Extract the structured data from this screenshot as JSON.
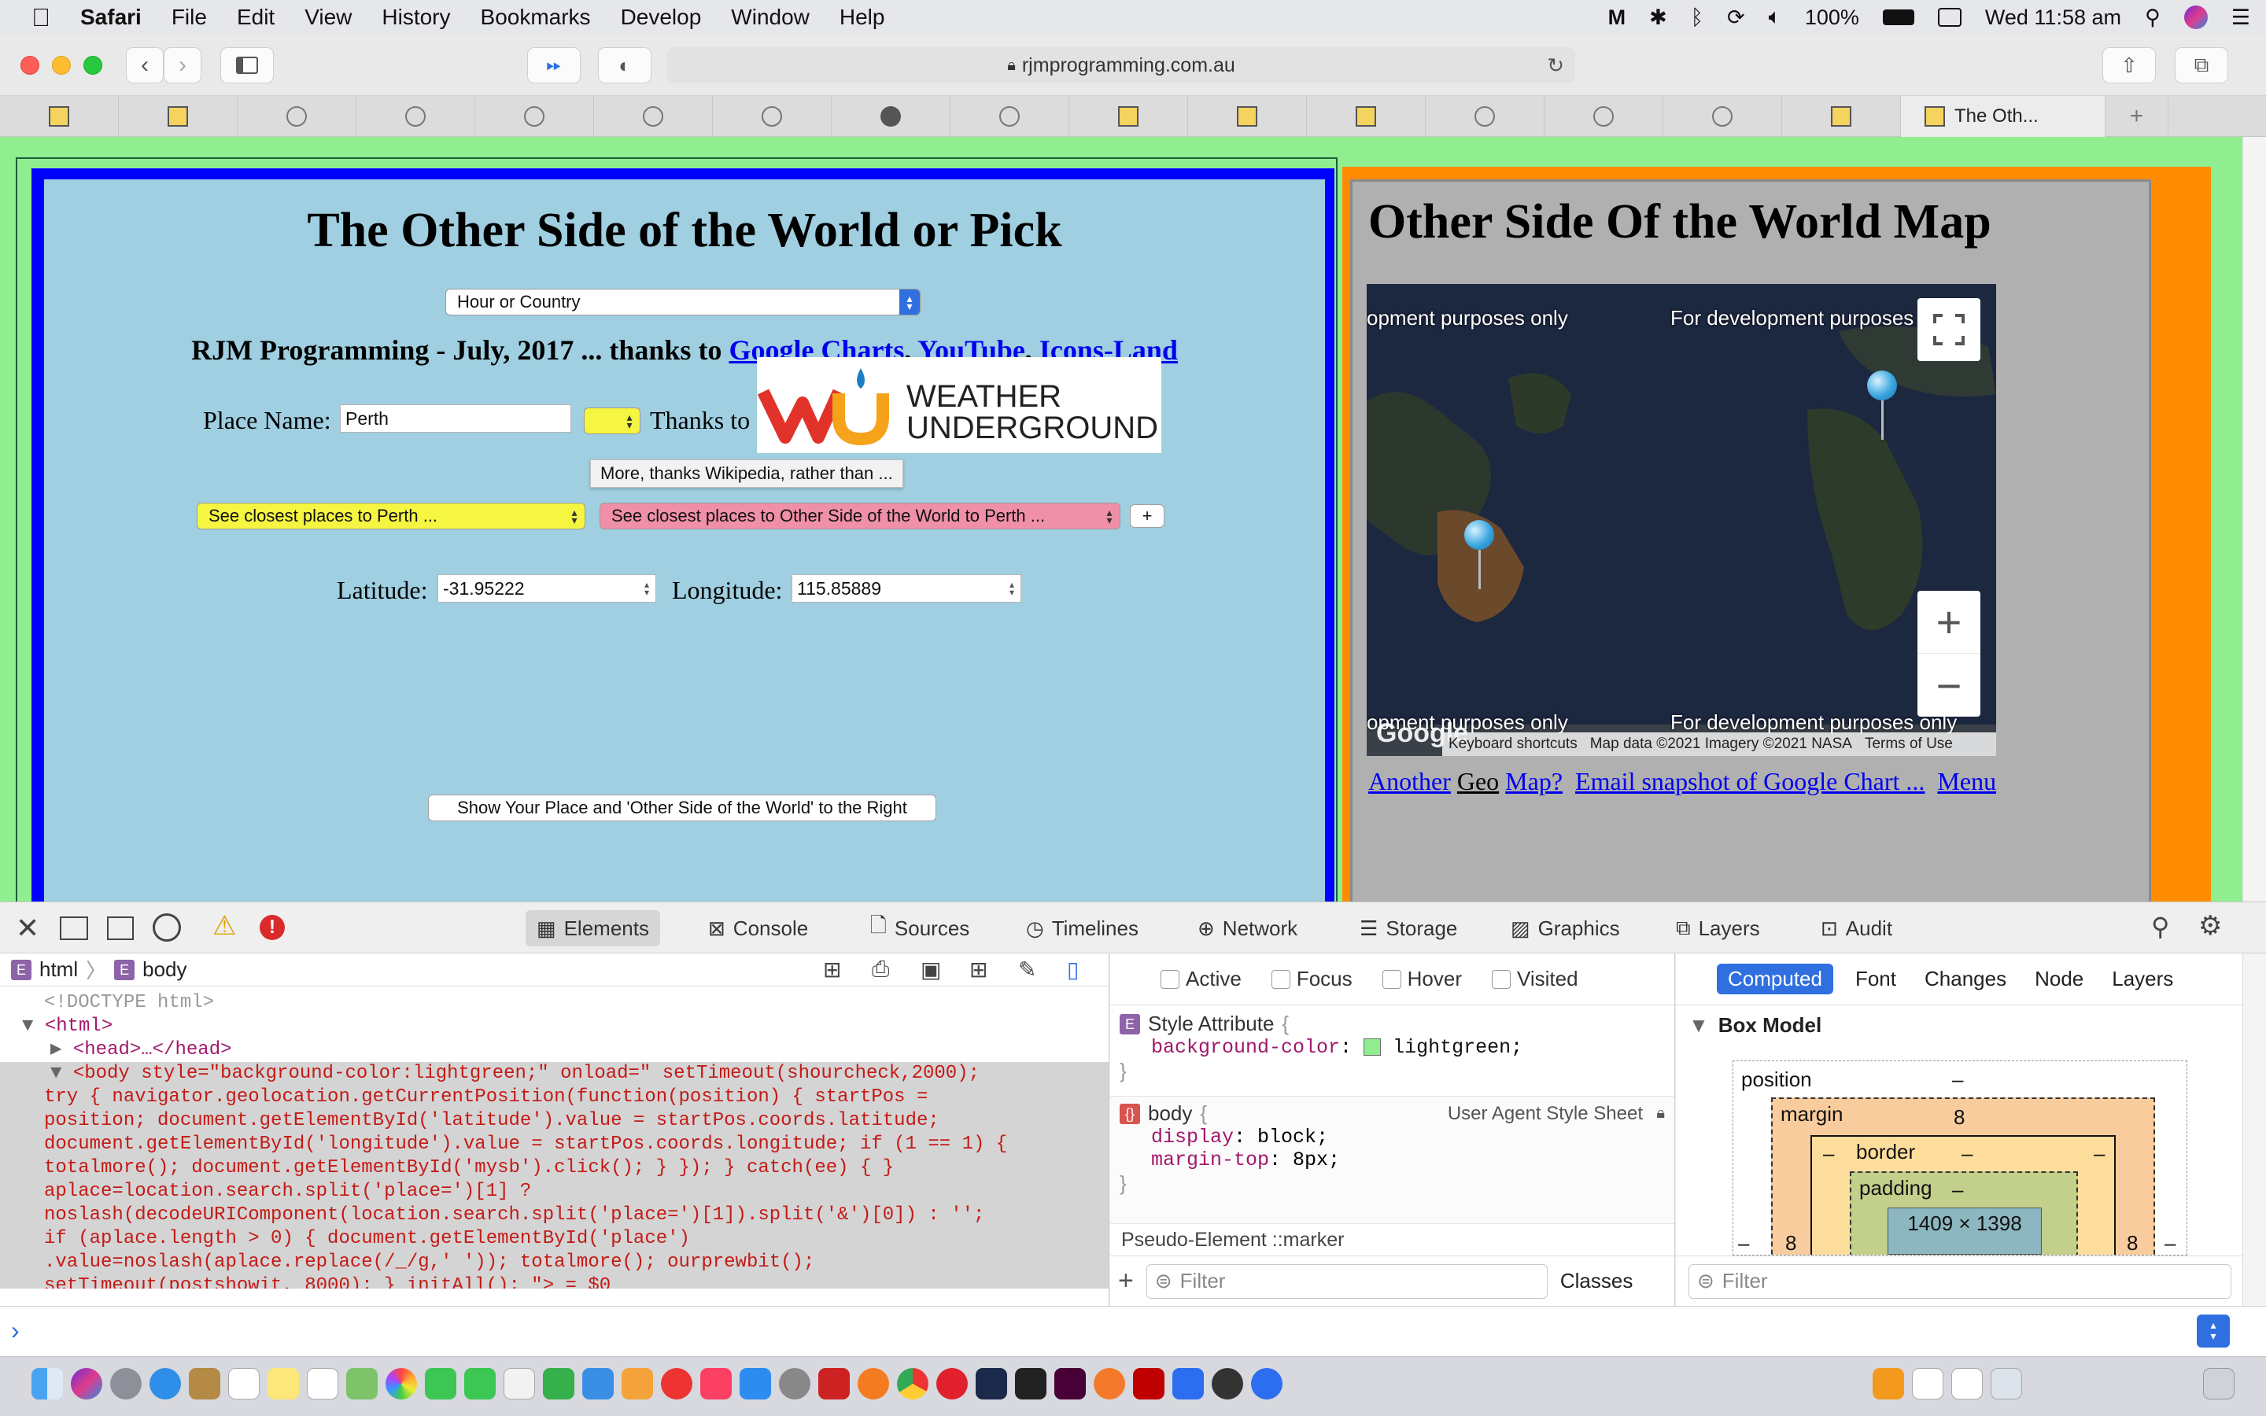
{
  "menubar": {
    "app": "Safari",
    "items": [
      "File",
      "Edit",
      "View",
      "History",
      "Bookmarks",
      "Develop",
      "Window",
      "Help"
    ],
    "battery": "100%",
    "clock": "Wed 11:58 am"
  },
  "toolbar": {
    "url": "rjmprogramming.com.au"
  },
  "tabs": {
    "active_label": "The Oth..."
  },
  "page": {
    "left_title": "The Other Side of the World or Pick",
    "hour_select": "Hour or Country",
    "credit_prefix": "RJM Programming - July, 2017 ... thanks to",
    "credit_links": [
      "Google Charts",
      "YouTube",
      "Icons-Land"
    ],
    "credit_seps": [
      ",",
      ","
    ],
    "place_label": "Place Name:",
    "place_value": "Perth",
    "thanks_to": "Thanks to",
    "weather_logo": [
      "WEATHER",
      "UNDERGROUND"
    ],
    "tooltip": "More, thanks Wikipedia, rather than ...",
    "closest_select": "See closest places to Perth ...",
    "other_select": "See closest places to Other Side of the World to Perth ...",
    "plus_button": "+",
    "lat_label": "Latitude:",
    "lat_value": "-31.95222",
    "lon_label": "Longitude:",
    "lon_value": "115.85889",
    "show_button": "Show Your Place and 'Other Side of the World' to the Right",
    "right_title": "Other Side Of the World Map",
    "map": {
      "watermark_tl": "opment purposes only",
      "watermark_tr": "For development purposes",
      "watermark_bl": "opment purposes only",
      "watermark_br": "For development purposes only",
      "google": "Google",
      "shortcuts": "Keyboard shortcuts",
      "mapdata": "Map data ©2021 Imagery ©2021 NASA",
      "terms": "Terms of Use",
      "zoom_in": "+",
      "zoom_out": "−"
    },
    "bottom_links": [
      "Another",
      "Geo",
      "Map?",
      "Email snapshot of Google Chart ...",
      "Menu"
    ]
  },
  "devtools": {
    "tabs": [
      "Elements",
      "Console",
      "Sources",
      "Timelines",
      "Network",
      "Storage",
      "Graphics",
      "Layers",
      "Audit"
    ],
    "breadcrumb": [
      "html",
      "body"
    ],
    "dom_lines": [
      "<!DOCTYPE html>",
      "<html>",
      "<head>…</head>",
      "<body style=\"background-color:lightgreen;\" onload=\" setTimeout(shourcheck,2000);",
      "try { navigator.geolocation.getCurrentPosition(function(position) { startPos =",
      "position; document.getElementById('latitude').value = startPos.coords.latitude;",
      "document.getElementById('longitude').value = startPos.coords.longitude; if (1 == 1) {",
      "totalmore(); document.getElementById('mysb').click(); } }); } catch(ee) { }",
      "aplace=location.search.split('place=')[1] ?",
      "noslash(decodeURIComponent(location.search.split('place=')[1]).split('&')[0]) : '';",
      "if (aplace.length > 0) { document.getElementById('place')",
      ".value=noslash(aplace.replace(/_/g,' ')); totalmore(); ourprewbit();",
      "setTimeout(postshowit, 8000); } initAll(); \"> = $0"
    ],
    "pseudo": [
      "Active",
      "Focus",
      "Hover",
      "Visited"
    ],
    "style_attr_header": "Style Attribute",
    "style_prop": "background-color",
    "style_val": "lightgreen",
    "body_rule": "body",
    "ua_sheet": "User Agent Style Sheet",
    "body_props": [
      {
        "name": "display",
        "value": "block"
      },
      {
        "name": "margin-top",
        "value": "8px"
      }
    ],
    "pseudo_marker": "Pseudo-Element ::marker",
    "filter": "Filter",
    "classes": "Classes",
    "computed_tabs": [
      "Computed",
      "Font",
      "Changes",
      "Node",
      "Layers"
    ],
    "box_model": "Box Model",
    "bm_position": "position",
    "bm_margin": "margin",
    "bm_margin_val": "8",
    "bm_border": "border",
    "bm_padding": "padding",
    "bm_dash": "–",
    "bm_size": "1409 × 1398",
    "bm_side": "8"
  },
  "colors": {
    "page_bg": "#90ee90",
    "left_border": "#0000ff",
    "left_bg": "#9fcfe0",
    "right_border": "#ff8c00",
    "link": "#0000ee",
    "yellow_select": "#f5f542",
    "pink_select": "#f08fa8"
  }
}
